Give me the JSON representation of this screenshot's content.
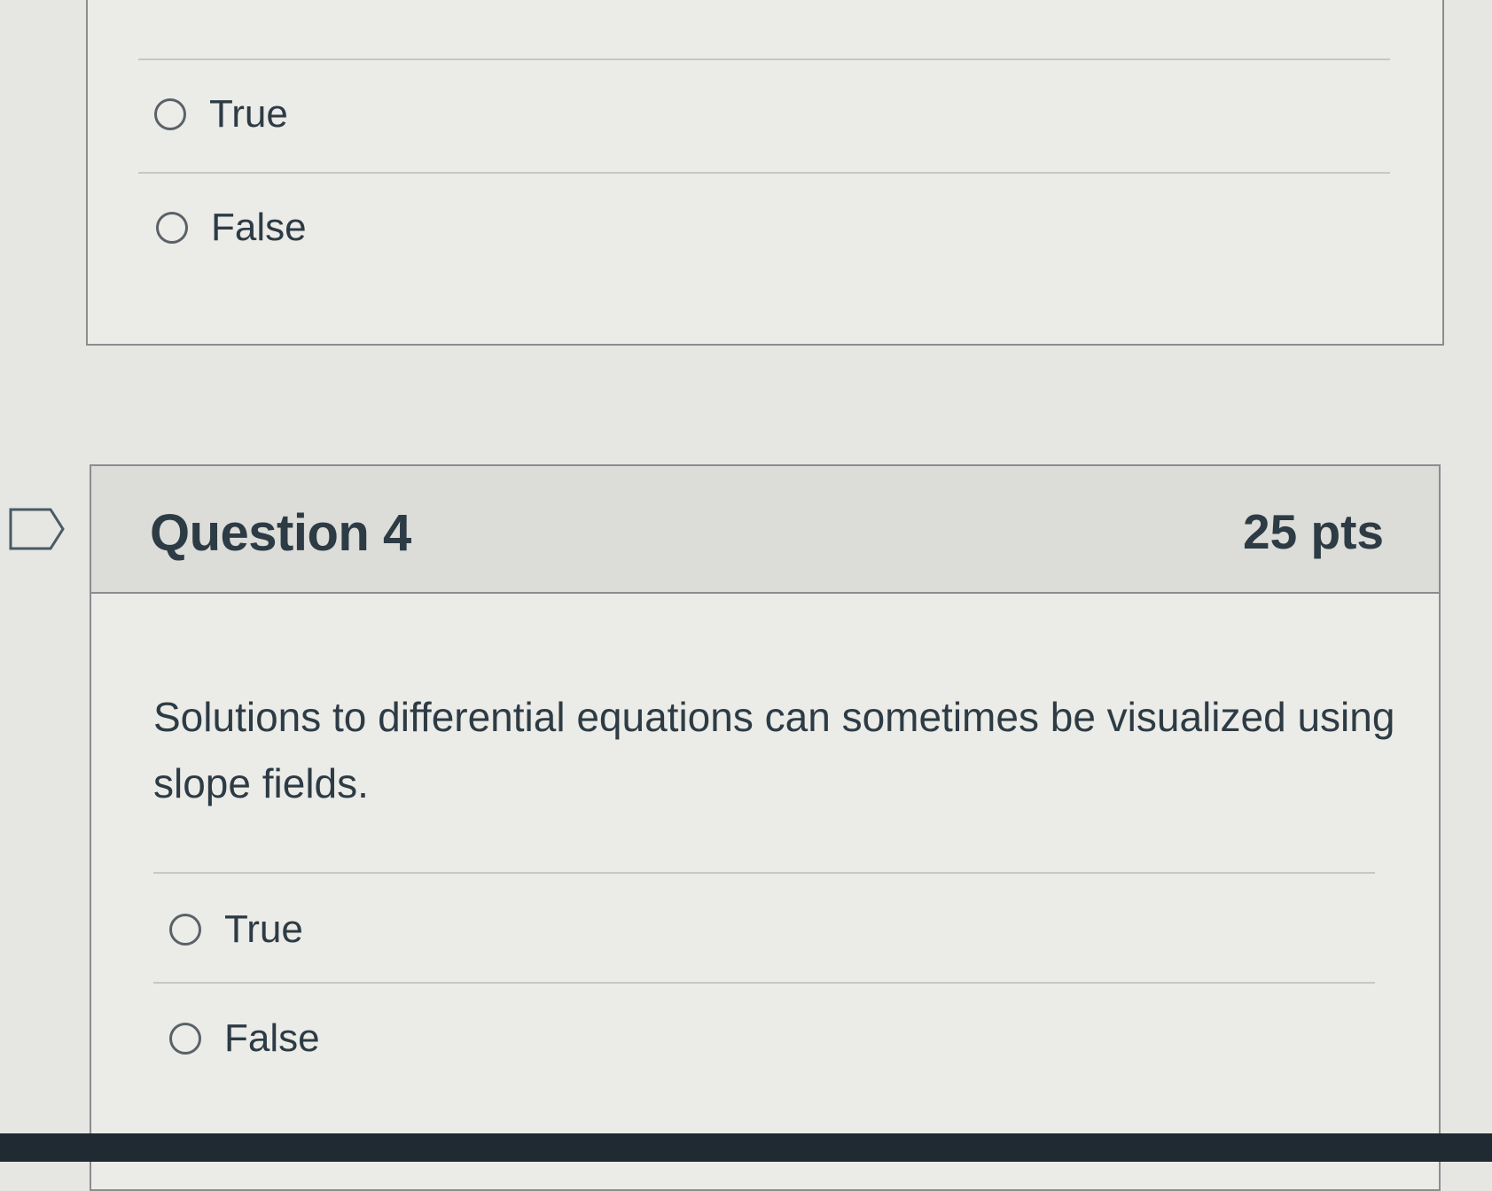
{
  "previous_question": {
    "answers": [
      {
        "label": "True"
      },
      {
        "label": "False"
      }
    ]
  },
  "question": {
    "title": "Question 4",
    "points": "25 pts",
    "text": "Solutions to differential equations can sometimes be visualized using slope fields.",
    "answers": [
      {
        "label": "True"
      },
      {
        "label": "False"
      }
    ]
  },
  "icons": {
    "flag": "flag-question-icon",
    "radio": "radio-button-icon"
  },
  "colors": {
    "text": "#2d3b45",
    "header_background": "#dcdcd8",
    "border": "#8a8d90",
    "bottom_bar": "#1f2a33"
  }
}
